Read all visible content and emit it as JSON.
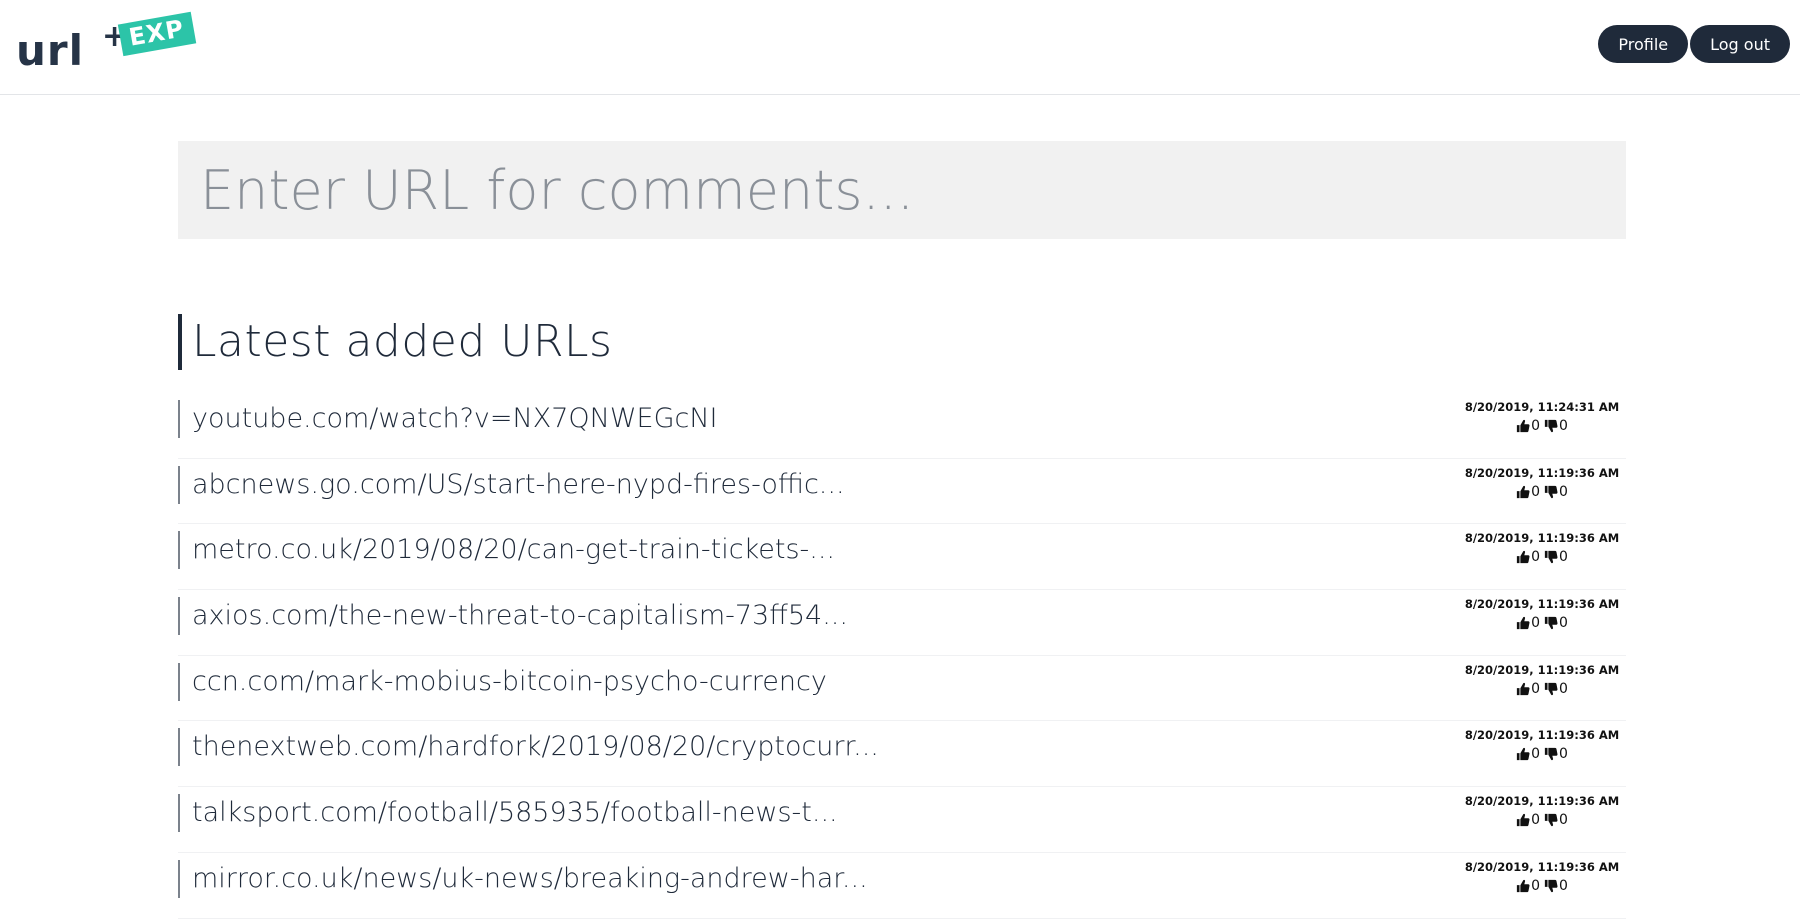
{
  "header": {
    "logo_text": "url",
    "logo_plus": "+",
    "logo_badge": "EXP",
    "profile_label": "Profile",
    "logout_label": "Log out"
  },
  "search": {
    "placeholder": "Enter URL for comments..."
  },
  "section": {
    "title": "Latest added URLs"
  },
  "urls": [
    {
      "url": "youtube.com/watch?v=NX7QNWEGcNI",
      "timestamp": "8/20/2019, 11:24:31 AM",
      "likes": "0",
      "dislikes": "0"
    },
    {
      "url": "abcnews.go.com/US/start-here-nypd-fires-offic...",
      "timestamp": "8/20/2019, 11:19:36 AM",
      "likes": "0",
      "dislikes": "0"
    },
    {
      "url": "metro.co.uk/2019/08/20/can-get-train-tickets-...",
      "timestamp": "8/20/2019, 11:19:36 AM",
      "likes": "0",
      "dislikes": "0"
    },
    {
      "url": "axios.com/the-new-threat-to-capitalism-73ff54...",
      "timestamp": "8/20/2019, 11:19:36 AM",
      "likes": "0",
      "dislikes": "0"
    },
    {
      "url": "ccn.com/mark-mobius-bitcoin-psycho-currency",
      "timestamp": "8/20/2019, 11:19:36 AM",
      "likes": "0",
      "dislikes": "0"
    },
    {
      "url": "thenextweb.com/hardfork/2019/08/20/cryptocurr...",
      "timestamp": "8/20/2019, 11:19:36 AM",
      "likes": "0",
      "dislikes": "0"
    },
    {
      "url": "talksport.com/football/585935/football-news-t...",
      "timestamp": "8/20/2019, 11:19:36 AM",
      "likes": "0",
      "dislikes": "0"
    },
    {
      "url": "mirror.co.uk/news/uk-news/breaking-andrew-har...",
      "timestamp": "8/20/2019, 11:19:36 AM",
      "likes": "0",
      "dislikes": "0"
    }
  ],
  "icons": {
    "like": "thumbs-up-icon",
    "dislike": "thumbs-down-icon"
  },
  "colors": {
    "primary": "#1f2a3a",
    "accent": "#2cc4a8",
    "search_bg": "#f1f1f1"
  }
}
